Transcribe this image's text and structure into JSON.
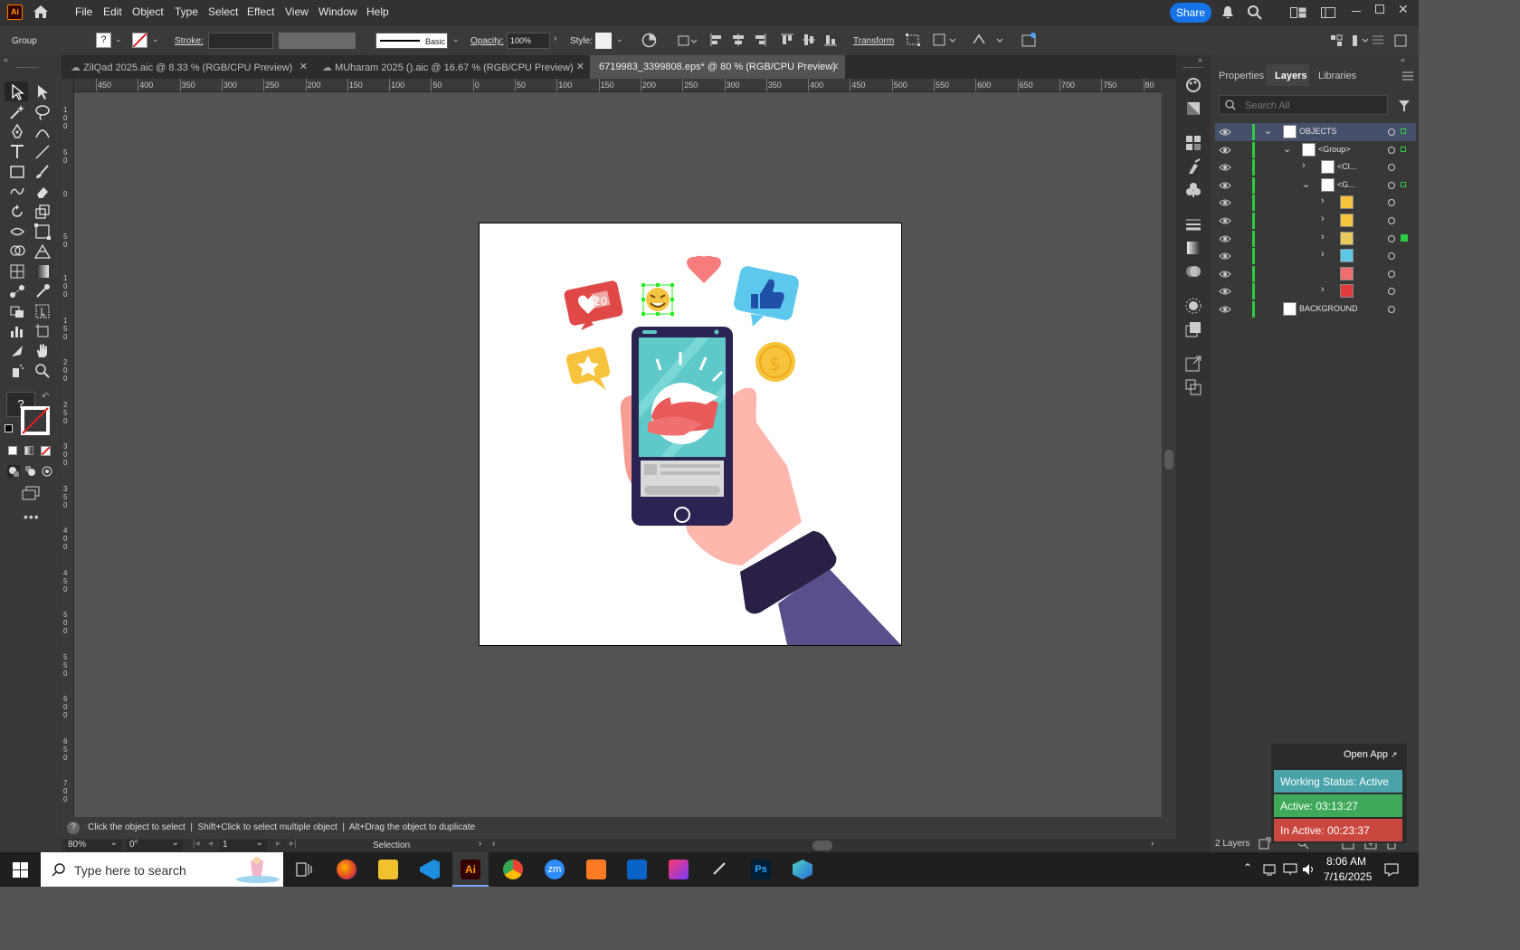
{
  "menubar": {
    "app_icon": "Ai",
    "items": [
      "File",
      "Edit",
      "Object",
      "Type",
      "Select",
      "Effect",
      "View",
      "Window",
      "Help"
    ],
    "share_label": "Share"
  },
  "controlbar": {
    "selection_type": "Group",
    "fill_value": "?",
    "stroke_label": "Stroke:",
    "brush_label": "Basic",
    "opacity_label": "Opacity:",
    "opacity_value": "100%",
    "style_label": "Style:",
    "transform_label": "Transform"
  },
  "tabs": [
    {
      "label": "ZilQad 2025.aic @ 8.33 % (RGB/CPU Preview)",
      "active": false
    },
    {
      "label": "MUharam 2025 ().aic @ 16.67 % (RGB/CPU Preview)",
      "active": false
    },
    {
      "label": "6719983_3399808.eps* @ 80 % (RGB/CPU Preview)",
      "active": true
    }
  ],
  "ruler": {
    "h_ticks": [
      "450",
      "400",
      "350",
      "300",
      "250",
      "200",
      "150",
      "100",
      "50",
      "0",
      "50",
      "100",
      "150",
      "200",
      "250",
      "300",
      "350",
      "400",
      "450",
      "500",
      "550",
      "600",
      "650",
      "700",
      "750",
      "80"
    ],
    "v_ticks": [
      "1 0 0",
      "5 0",
      "0",
      "5 0",
      "1 0 0",
      "1 5 0",
      "2 0 0",
      "2 5 0",
      "3 0 0",
      "3 5 0",
      "4 0 0",
      "4 5 0",
      "5 0 0",
      "5 5 0",
      "6 0 0",
      "6 5 0",
      "7 0 0"
    ]
  },
  "panel": {
    "tabs": [
      "Properties",
      "Layers",
      "Libraries"
    ],
    "active_tab": "Layers",
    "search_placeholder": "Search All",
    "layers": [
      {
        "name": "OBJECTS",
        "indent": 0,
        "expanded": true,
        "selected": true
      },
      {
        "name": "<Group>",
        "indent": 1,
        "expanded": true
      },
      {
        "name": "<Cl...",
        "indent": 2,
        "expanded": false
      },
      {
        "name": "<G...",
        "indent": 2,
        "expanded": true
      },
      {
        "name": "",
        "indent": 3,
        "expanded": false,
        "thumb": "#f7c33c"
      },
      {
        "name": "",
        "indent": 3,
        "expanded": false,
        "thumb": "#f7c33c"
      },
      {
        "name": "",
        "indent": 3,
        "expanded": false,
        "thumb": "#e8c95a"
      },
      {
        "name": "",
        "indent": 3,
        "expanded": false,
        "thumb": "#5bc8e8"
      },
      {
        "name": "",
        "indent": 3,
        "thumb": "#f07070"
      },
      {
        "name": "",
        "indent": 3,
        "expanded": false,
        "thumb": "#e03c3c"
      },
      {
        "name": "BACKGROUND",
        "indent": 0,
        "thumb": "#ffffff"
      }
    ],
    "layer_count": "2 Layers"
  },
  "status": {
    "hint": "Click the object to select  |  Shift+Click to select multiple object  |  Alt+Drag the object to duplicate",
    "zoom": "80%",
    "rotation": "0°",
    "artboard": "1",
    "tool_name": "Selection"
  },
  "widget": {
    "open_app": "Open App",
    "working_status": "Working Status: Active",
    "active": "Active: 03:13:27",
    "inactive": "In Active: 00:23:37",
    "colors": {
      "status": "#4aa3a8",
      "active": "#3fa95a",
      "inactive": "#c9473e"
    }
  },
  "taskbar": {
    "search_placeholder": "Type here to search",
    "time": "8:06 AM",
    "date": "7/16/2025"
  },
  "artwork": {
    "badge_count": "20",
    "accent_red": "#e04848",
    "phone_color": "#2b2452",
    "screen_color": "#5fc9c9"
  }
}
